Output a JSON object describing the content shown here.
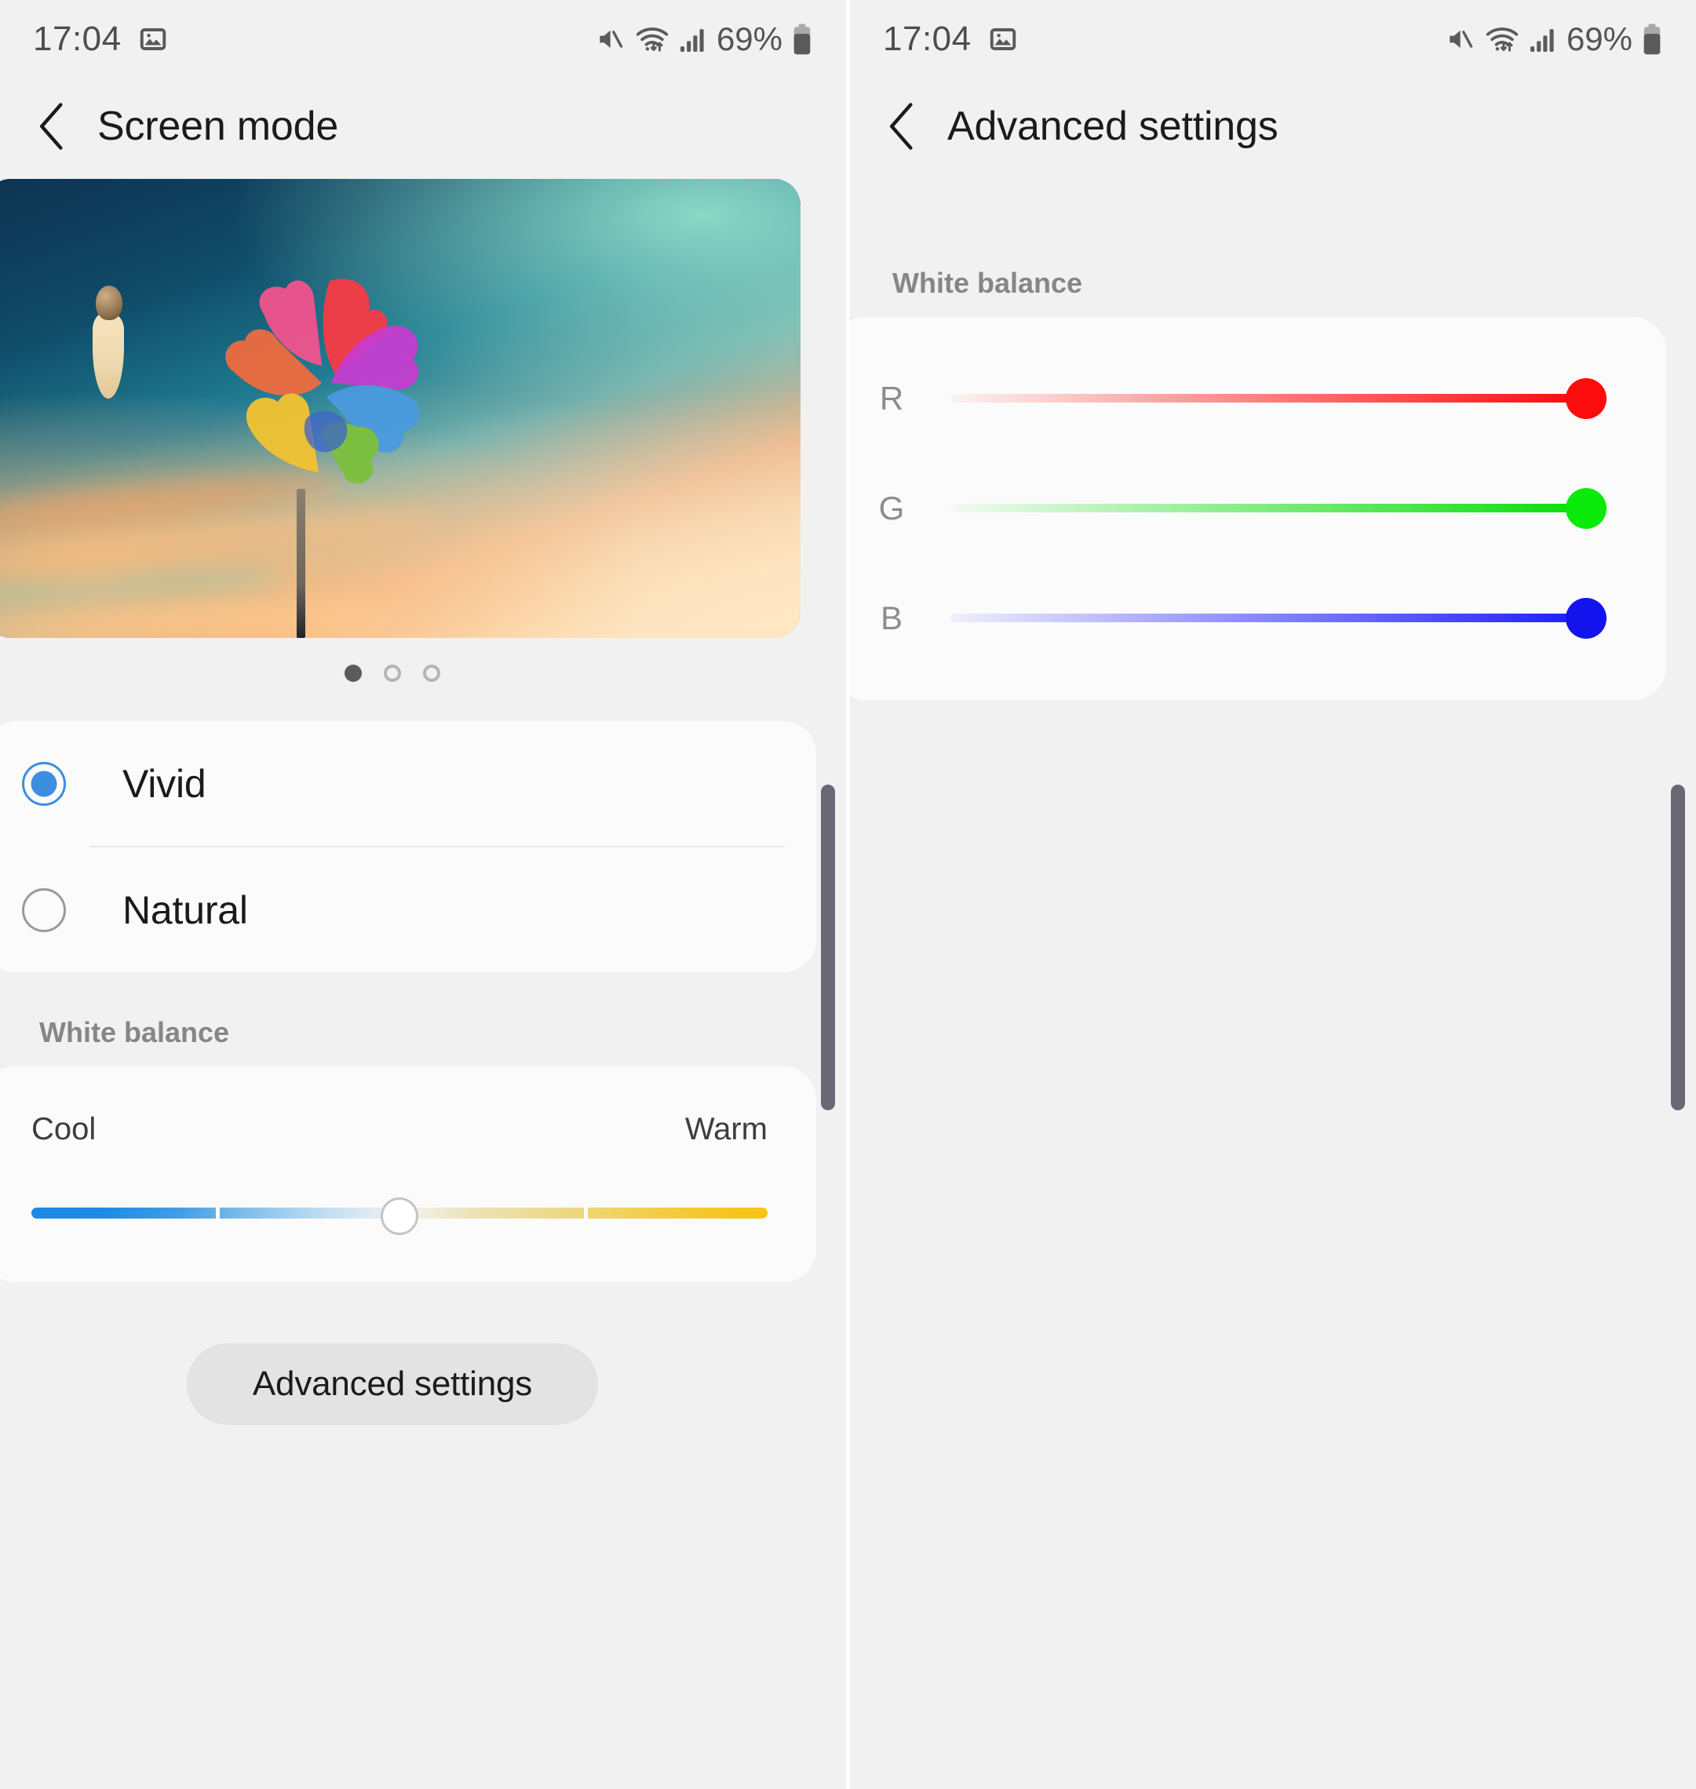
{
  "statusbar": {
    "time": "17:04",
    "battery_percent": "69%",
    "icons": [
      "image-icon",
      "mute-icon",
      "wifi-icon",
      "signal-icon",
      "battery-icon"
    ]
  },
  "left_screen": {
    "title": "Screen mode",
    "back_icon": "back-chevron-icon",
    "preview": {
      "alt": "pinwheel-preview-image",
      "page_dots": [
        "active",
        "inactive",
        "inactive"
      ]
    },
    "modes": {
      "options": [
        {
          "label": "Vivid",
          "selected": true
        },
        {
          "label": "Natural",
          "selected": false
        }
      ]
    },
    "white_balance": {
      "section_label": "White balance",
      "cool_label": "Cool",
      "warm_label": "Warm",
      "value_percent": 50
    },
    "advanced_button": "Advanced settings"
  },
  "right_screen": {
    "title": "Advanced settings",
    "back_icon": "back-chevron-icon",
    "white_balance": {
      "section_label": "White balance",
      "channels": [
        {
          "label": "R",
          "value_percent": 100,
          "color": "#fc0d0d"
        },
        {
          "label": "G",
          "value_percent": 100,
          "color": "#0bea0b"
        },
        {
          "label": "B",
          "value_percent": 100,
          "color": "#1313ee"
        }
      ]
    }
  },
  "colors": {
    "background": "#f1f1f1",
    "card": "#fbfbfb",
    "accent": "#3d8ee0",
    "button": "#e3e3e3",
    "scrollbar": "#6b6875",
    "section_label": "#868686"
  }
}
